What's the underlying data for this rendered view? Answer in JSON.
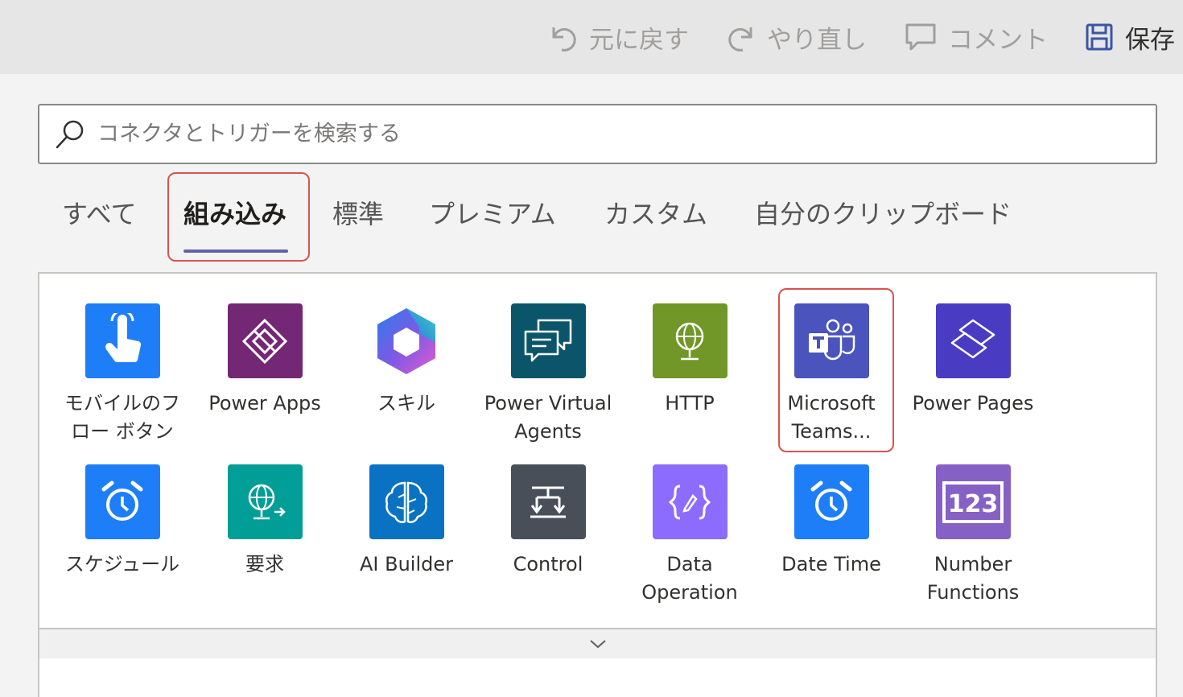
{
  "toolbar": {
    "undo_label": "元に戻す",
    "redo_label": "やり直し",
    "comment_label": "コメント",
    "save_label": "保存"
  },
  "search": {
    "placeholder": "コネクタとトリガーを検索する"
  },
  "tabs": [
    {
      "label": "すべて"
    },
    {
      "label": "組み込み"
    },
    {
      "label": "標準"
    },
    {
      "label": "プレミアム"
    },
    {
      "label": "カスタム"
    },
    {
      "label": "自分のクリップボード"
    }
  ],
  "selected_tab": "組み込み",
  "connectors": [
    {
      "label": "モバイルのフ\nロー ボタン",
      "icon": "touch-icon",
      "color": "#1e7ef7"
    },
    {
      "label": "Power Apps",
      "icon": "power-apps-icon",
      "color": "#742774"
    },
    {
      "label": "スキル",
      "icon": "copilot-skills-icon",
      "color": "#6b5ad9"
    },
    {
      "label": "Power Virtual\nAgents",
      "icon": "chat-bubbles-icon",
      "color": "#0b556a"
    },
    {
      "label": "HTTP",
      "icon": "globe-icon",
      "color": "#709727"
    },
    {
      "label": "Microsoft\nTeams...",
      "icon": "teams-icon",
      "color": "#4b53bc"
    },
    {
      "label": "Power Pages",
      "icon": "power-pages-icon",
      "color": "#4a3cc2"
    },
    {
      "label": "スケジュール",
      "icon": "alarm-clock-icon",
      "color": "#1e7ef7"
    },
    {
      "label": "要求",
      "icon": "globe-request-icon",
      "color": "#009e96"
    },
    {
      "label": "AI Builder",
      "icon": "brain-icon",
      "color": "#0a72c2"
    },
    {
      "label": "Control",
      "icon": "control-icon",
      "color": "#484f58"
    },
    {
      "label": "Data\nOperation",
      "icon": "curly-braces-icon",
      "color": "#8c6cff"
    },
    {
      "label": "Date Time",
      "icon": "alarm-clock-icon",
      "color": "#1e7ef7"
    },
    {
      "label": "Number\nFunctions",
      "icon": "number-123-icon",
      "color": "#8661c5"
    }
  ],
  "icons": {
    "search": "search-icon",
    "expand": "chevron-down-icon"
  },
  "colors": {
    "tab_underline": "#6264a7",
    "highlight_box": "#d9534f"
  }
}
